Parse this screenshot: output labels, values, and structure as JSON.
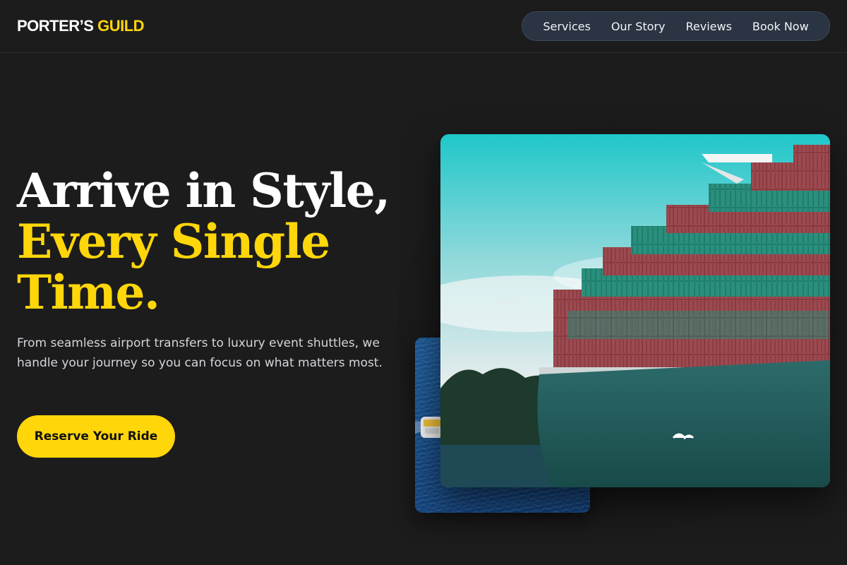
{
  "brand": {
    "name_part1": "PORTER’S",
    "name_part2": "GUILD"
  },
  "nav": {
    "items": [
      {
        "label": "Services"
      },
      {
        "label": "Our Story"
      },
      {
        "label": "Reviews"
      },
      {
        "label": "Book Now"
      }
    ]
  },
  "hero": {
    "headline_line1": "Arrive in Style,",
    "headline_line2": "Every Single",
    "headline_line3": "Time.",
    "subtext": "From seamless airport transfers to luxury event shuttles, we handle your journey so you can focus on what matters most.",
    "cta_label": "Reserve Your Ride"
  },
  "images": {
    "main": "container-ship-photo",
    "secondary": "aerial-sea-boat-photo"
  },
  "colors": {
    "background": "#1c1c1d",
    "accent": "#ffd60a",
    "nav_bg": "#2a3442",
    "text_muted": "#d4d6da"
  }
}
